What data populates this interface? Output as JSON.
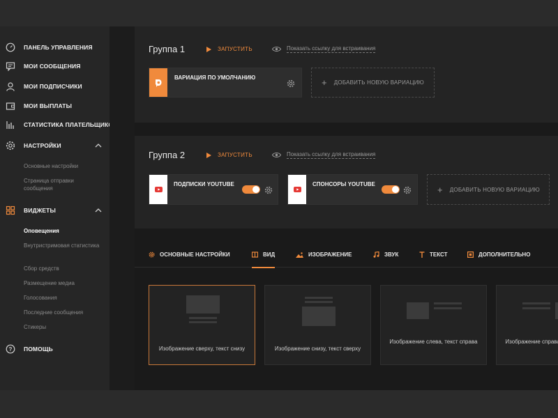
{
  "sidebar": {
    "items": [
      {
        "label": "ПАНЕЛЬ УПРАВЛЕНИЯ",
        "icon": "speedometer-icon"
      },
      {
        "label": "МОИ СООБЩЕНИЯ",
        "icon": "message-icon"
      },
      {
        "label": "МОИ ПОДПИСЧИКИ",
        "icon": "user-icon"
      },
      {
        "label": "МОИ ВЫПЛАТЫ",
        "icon": "wallet-icon"
      },
      {
        "label": "СТАТИСТИКА ПЛАТЕЛЬЩИКОВ",
        "icon": "bar-chart-icon"
      },
      {
        "label": "НАСТРОЙКИ",
        "icon": "gear-icon"
      },
      {
        "label": "ВИДЖЕТЫ",
        "icon": "widgets-grid-icon"
      },
      {
        "label": "ПОМОЩЬ",
        "icon": "help-icon"
      }
    ],
    "settings_sub": [
      "Основные настройки",
      "Страница отправки сообщения"
    ],
    "widgets_sub": [
      "Оповещения",
      "Внутристримовая статистика",
      "Сбор средств",
      "Размещение медиа",
      "Голосования",
      "Последние сообщения",
      "Стикеры"
    ]
  },
  "group1": {
    "title": "Группа 1",
    "run_label": "ЗАПУСТИТЬ",
    "embed_label": "Показать ссылку для встраивания",
    "variations": [
      {
        "label": "ВАРИАЦИЯ ПО УМОЛЧАНИЮ",
        "icon": "donationalerts-logo-icon"
      }
    ],
    "add_label": "ДОБАВИТЬ НОВУЮ ВАРИАЦИЮ"
  },
  "group2": {
    "title": "Группа 2",
    "run_label": "ЗАПУСТИТЬ",
    "embed_label": "Показать ссылку для встраивания",
    "variations": [
      {
        "label": "ПОДПИСКИ YOUTUBE",
        "icon": "youtube-icon",
        "enabled": true
      },
      {
        "label": "СПОНСОРЫ YOUTUBE",
        "icon": "youtube-icon",
        "enabled": true
      }
    ],
    "add_label": "ДОБАВИТЬ НОВУЮ ВАРИАЦИЮ"
  },
  "tabs": [
    {
      "label": "ОСНОВНЫЕ НАСТРОЙКИ",
      "icon": "gear-icon"
    },
    {
      "label": "ВИД",
      "icon": "view-icon",
      "active": true
    },
    {
      "label": "ИЗОБРАЖЕНИЕ",
      "icon": "image-icon"
    },
    {
      "label": "ЗВУК",
      "icon": "music-note-icon"
    },
    {
      "label": "ТЕКСТ",
      "icon": "text-icon"
    },
    {
      "label": "ДОПОЛНИТЕЛЬНО",
      "icon": "advanced-icon"
    }
  ],
  "layouts": [
    {
      "label": "Изображение сверху, текст снизу",
      "selected": true
    },
    {
      "label": "Изображение снизу, текст сверху"
    },
    {
      "label": "Изображение слева, текст справа"
    },
    {
      "label": "Изображение справа, текст слева"
    }
  ],
  "colors": {
    "accent": "#f08a3c",
    "bg": "#1a1a1a",
    "card": "#242424",
    "youtube": "#e53935"
  }
}
